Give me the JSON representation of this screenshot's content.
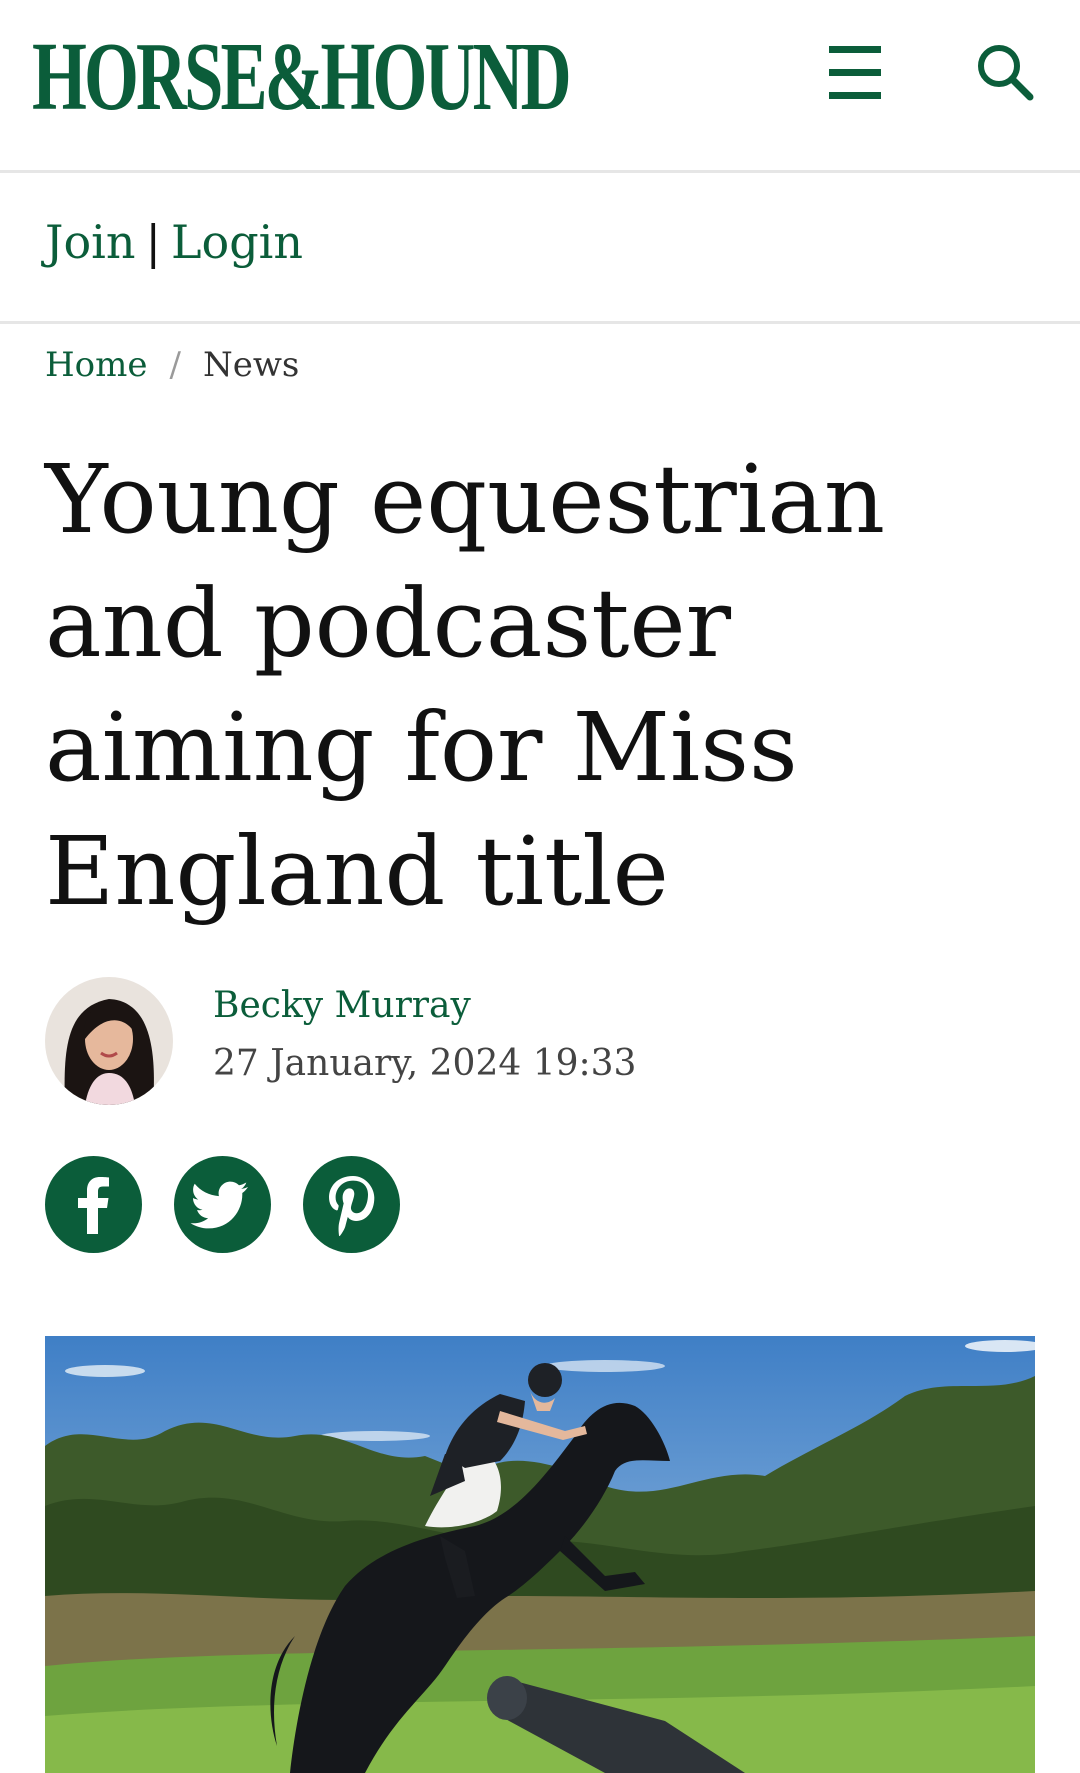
{
  "header": {
    "logo_text": "HORSE&HOUND",
    "menu_icon": "hamburger-menu-icon",
    "search_icon": "search-icon",
    "brand_color": "#0b5d3a"
  },
  "account": {
    "join_label": "Join",
    "separator": "|",
    "login_label": "Login"
  },
  "breadcrumb": {
    "home": "Home",
    "separator": "/",
    "current": "News"
  },
  "article": {
    "headline": "Young equestrian and podcaster aiming for Miss England title",
    "author": "Becky Murray",
    "date": "27 January, 2024 19:33"
  },
  "share_icons": [
    "facebook-icon",
    "twitter-icon",
    "pinterest-icon"
  ]
}
